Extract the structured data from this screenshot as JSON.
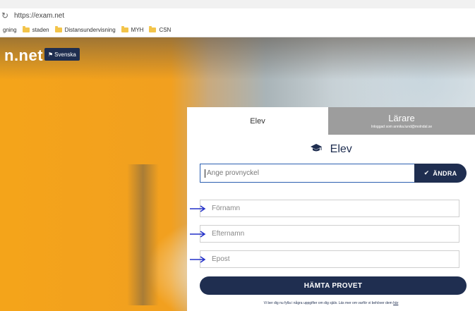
{
  "browser": {
    "url": "https://exam.net",
    "bookmarks": [
      {
        "label": "gning",
        "folder": false
      },
      {
        "label": "staden",
        "folder": true
      },
      {
        "label": "Distansundervisning",
        "folder": true
      },
      {
        "label": "MYH",
        "folder": true
      },
      {
        "label": "CSN",
        "folder": true
      }
    ]
  },
  "header": {
    "logo": "n.net",
    "language": "Svenska"
  },
  "tabs": {
    "student": "Elev",
    "teacher": "Lärare",
    "teacher_sub": "Inloggad som annika.lund@molndal.se"
  },
  "form": {
    "heading": "Elev",
    "key_placeholder": "Ange provnyckel",
    "change_label": "ÄNDRA",
    "first_name_placeholder": "Förnamn",
    "last_name_placeholder": "Efternamn",
    "email_placeholder": "Epost",
    "submit_label": "HÄMTA PROVET",
    "footnote": "Vi ber dig nu fylla i några uppgifter om dig själv. Läs mer om varför vi behöver dem",
    "footnote_link": "här"
  },
  "colors": {
    "primary": "#1f2e50",
    "accent_orange": "#f4a41a",
    "teacher_tab": "#9d9d9d",
    "annotation_arrow": "#2431c9"
  },
  "icons": {
    "heading_icon": "graduation-cap-icon",
    "change_icon": "check-icon",
    "language_icon": "flag-icon"
  }
}
